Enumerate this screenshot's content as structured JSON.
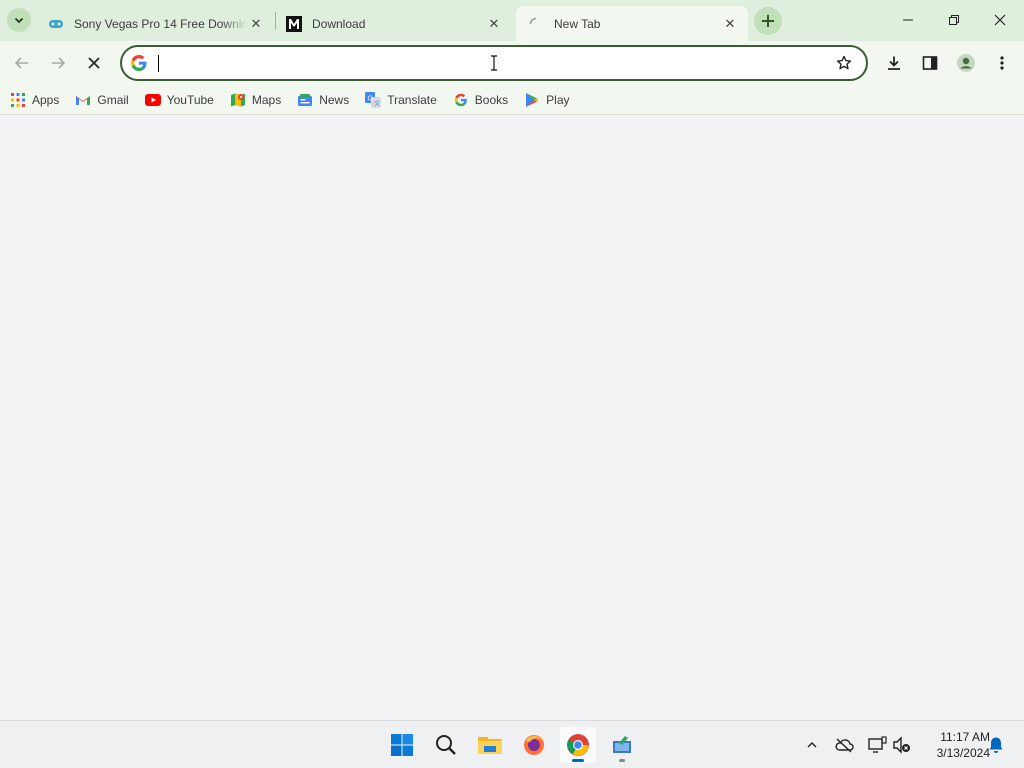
{
  "tabs": [
    {
      "title": "Sony Vegas Pro 14 Free Download",
      "active": false
    },
    {
      "title": "Download",
      "active": false
    },
    {
      "title": "New Tab",
      "active": true
    }
  ],
  "omnibox": {
    "value": "",
    "placeholder": ""
  },
  "bookmarks": [
    {
      "label": "Apps",
      "icon": "apps-grid-icon"
    },
    {
      "label": "Gmail",
      "icon": "gmail-icon"
    },
    {
      "label": "YouTube",
      "icon": "youtube-icon"
    },
    {
      "label": "Maps",
      "icon": "maps-icon"
    },
    {
      "label": "News",
      "icon": "news-icon"
    },
    {
      "label": "Translate",
      "icon": "translate-icon"
    },
    {
      "label": "Books",
      "icon": "google-books-icon"
    },
    {
      "label": "Play",
      "icon": "google-play-icon"
    }
  ],
  "taskbar": {
    "apps": [
      "start-icon",
      "search-icon",
      "file-explorer-icon",
      "firefox-icon",
      "chrome-icon",
      "app-icon"
    ]
  },
  "clock": {
    "time": "11:17 AM",
    "date": "3/13/2024"
  },
  "colors": {
    "accent": "#0067c0",
    "tabstrip": "#dfeedd",
    "toolbar": "#f2f8f0",
    "omnibox_border": "#3b5c34"
  }
}
